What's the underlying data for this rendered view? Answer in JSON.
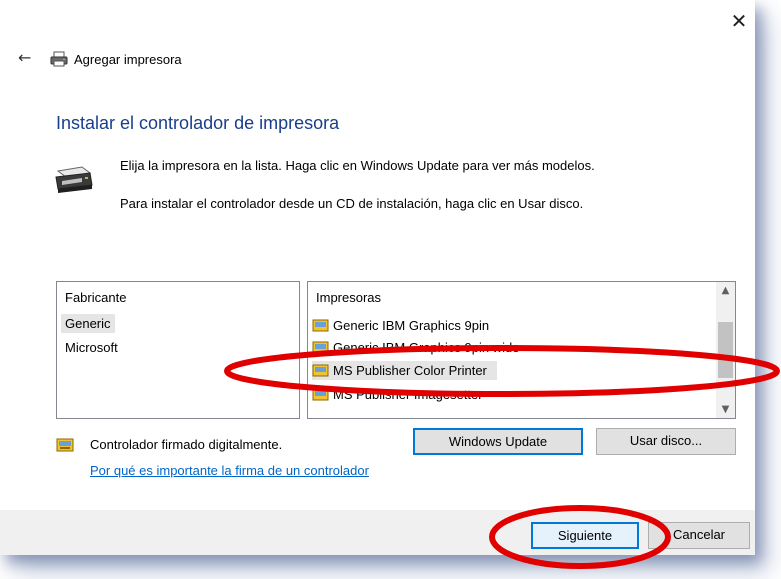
{
  "window": {
    "title": "Agregar impresora",
    "close_glyph": "✕",
    "back_glyph": "←"
  },
  "page": {
    "heading": "Instalar el controlador de impresora",
    "instruction_1": "Elija la impresora en la lista. Haga clic en Windows Update para ver más modelos.",
    "instruction_2": "Para instalar el controlador desde un CD de instalación, haga clic en Usar disco."
  },
  "manufacturers": {
    "header": "Fabricante",
    "items": [
      "Generic",
      "Microsoft"
    ],
    "selected": "Generic"
  },
  "printers": {
    "header": "Impresoras",
    "items": [
      "Generic IBM Graphics 9pin",
      "Generic IBM Graphics 9pin wide",
      "MS Publisher Color Printer",
      "MS Publisher Imagesetter"
    ],
    "selected": "MS Publisher Color Printer"
  },
  "driver": {
    "signed_text": "Controlador firmado digitalmente.",
    "signature_link": "Por qué es importante la firma de un controlador"
  },
  "buttons": {
    "windows_update": "Windows Update",
    "have_disk": "Usar disco...",
    "next": "Siguiente",
    "cancel": "Cancelar"
  },
  "colors": {
    "heading": "#1a3e8c",
    "link": "#0066cc",
    "focus_border": "#0078d7",
    "annotation_red": "#e00000"
  },
  "icons": {
    "title": "printer-icon",
    "instruction": "printer-large-icon",
    "signed": "signed-driver-icon",
    "printer_item": "printer-driver-icon"
  }
}
